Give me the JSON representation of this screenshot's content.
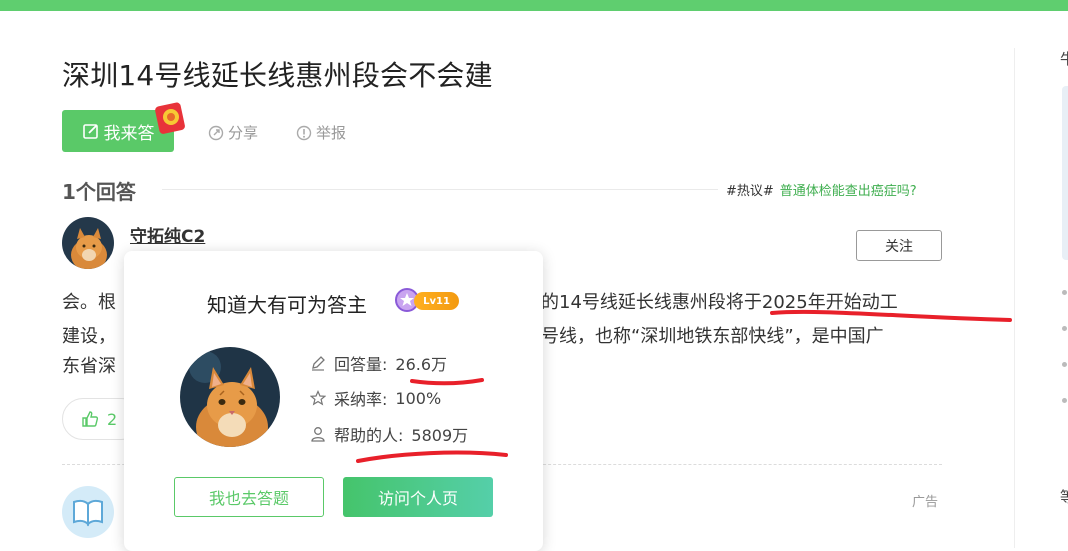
{
  "colors": {
    "brand_green": "#5ac968",
    "annotation_red": "#e8202a",
    "link_green": "#3fae4f"
  },
  "question": {
    "title": "深圳14号线延长线惠州段会不会建"
  },
  "actions": {
    "answer_label": "我来答",
    "answer_icon": "edit-icon",
    "share_label": "分享",
    "share_icon": "share-icon",
    "report_label": "举报",
    "report_icon": "report-icon"
  },
  "answers_header": {
    "count_label": "1个回答",
    "hot_tag": "#热议#",
    "hot_link": "普通体检能查出癌症吗?"
  },
  "answerer": {
    "name": "守拓纯C2",
    "follow_label": "关注"
  },
  "answer": {
    "line1_left": "会。根",
    "line1_right": "的14号线延长线惠州段将于2025年开始动工",
    "line2_left": "建设，",
    "line2_right": "号线，也称“深圳地铁东部快线”，是中国广",
    "line3_left": "东省深"
  },
  "like": {
    "count": "2",
    "icon": "thumbs-up-icon"
  },
  "ad_label": "广告",
  "right_column": {
    "char1": "牛",
    "char2": "等"
  },
  "profile_popup": {
    "title": "知道大有可为答主",
    "level": "Lv11",
    "stats": [
      {
        "icon": "pencil-icon",
        "label": "回答量:",
        "value": "26.6万"
      },
      {
        "icon": "star-icon",
        "label": "采纳率:",
        "value": "100%"
      },
      {
        "icon": "person-icon",
        "label": "帮助的人:",
        "value": "5809万"
      }
    ],
    "answer_button": "我也去答题",
    "visit_button": "访问个人页"
  }
}
